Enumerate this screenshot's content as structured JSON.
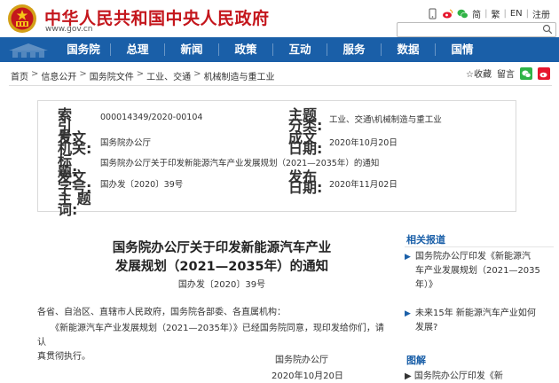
{
  "header": {
    "site_title": "中华人民共和国中央人民政府",
    "site_url": "www.gov.cn",
    "top_links": [
      "简",
      "繁",
      "EN",
      "注册"
    ],
    "icons": [
      "mobile-icon",
      "weibo-icon",
      "wechat-icon",
      "user-icon"
    ]
  },
  "nav": {
    "items": [
      "国务院",
      "总理",
      "新闻",
      "政策",
      "互动",
      "服务",
      "数据",
      "国情"
    ]
  },
  "breadcrumb": [
    "首页",
    "信息公开",
    "国务院文件",
    "工业、交通",
    "机械制造与重工业"
  ],
  "share": {
    "favorite_label": "☆收藏",
    "share_label": "留言"
  },
  "meta": {
    "index_label": "索　引　号:",
    "index_value": "000014349/2020-00104",
    "category_label": "主题分类:",
    "category_value": "工业、交通\\机械制造与重工业",
    "issuer_label": "发文机关:",
    "issuer_value": "国务院办公厅",
    "date_label": "成文日期:",
    "date_value": "2020年10月20日",
    "title_label": "标　　题:",
    "title_value": "国务院办公厅关于印发新能源汽车产业发展规划（2021—2035年）的通知",
    "doc_label": "发文字号:",
    "doc_value": "国办发〔2020〕39号",
    "pub_label": "发布日期:",
    "pub_value": "2020年11月02日",
    "subject_label": "主 题 词:",
    "subject_value": ""
  },
  "article": {
    "title_line1": "国务院办公厅关于印发新能源汽车产业",
    "title_line2": "发展规划（2021—2035年）的通知",
    "doc_number": "国办发〔2020〕39号",
    "para1": "各省、自治区、直辖市人民政府，国务院各部委、各直属机构：",
    "para2_line1": "　　《新能源汽车产业发展规划（2021—2035年）》已经国务院同意，现印发给你们，请认",
    "para2_line2": "真贯彻执行。",
    "sign_org": "国务院办公厅",
    "sign_date": "2020年10月20日"
  },
  "sidebar": {
    "related_title": "相关报道",
    "related": [
      {
        "bullet": "▶",
        "line1": "国务院办公厅印发《新能源汽",
        "line2": "车产业发展规划（2021—2035",
        "line3": "年）》"
      },
      {
        "bullet": "▶",
        "line1": "未来15年 新能源汽车产业如何",
        "line2": "发展?",
        "line3": ""
      }
    ],
    "graph_title": "图解",
    "graph_item": "▶  国务院办公厅印发《新"
  },
  "colors": {
    "brand_red": "#c4161c",
    "nav_blue": "#1a5fa8"
  }
}
